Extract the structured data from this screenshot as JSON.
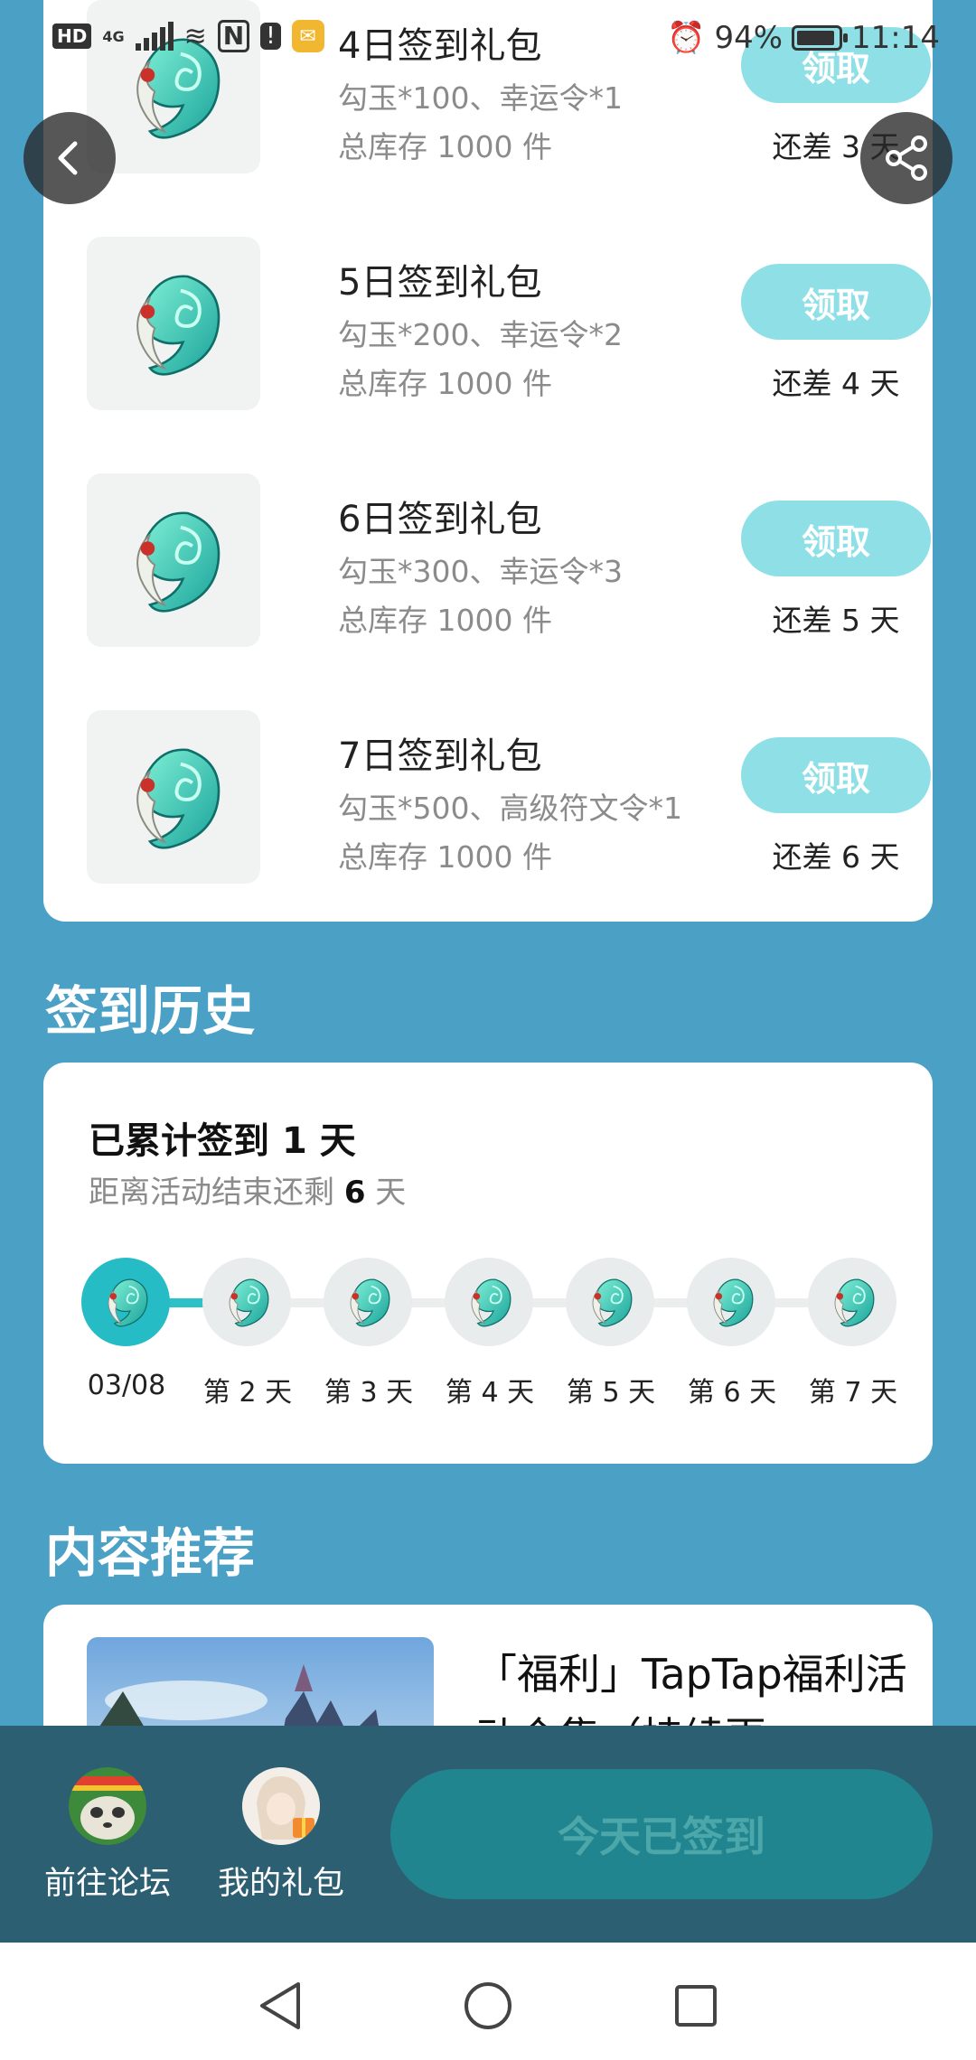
{
  "status_bar": {
    "hd": "HD",
    "network": "4G",
    "battery": "94%",
    "battery_level": 0.94,
    "time": "11:14"
  },
  "gifts": [
    {
      "title": "4日签到礼包",
      "desc": "勾玉*100、幸运令*1",
      "stock": "总库存 1000 件",
      "button": "领取",
      "remain": "还差 3 天"
    },
    {
      "title": "5日签到礼包",
      "desc": "勾玉*200、幸运令*2",
      "stock": "总库存 1000 件",
      "button": "领取",
      "remain": "还差 4 天"
    },
    {
      "title": "6日签到礼包",
      "desc": "勾玉*300、幸运令*3",
      "stock": "总库存 1000 件",
      "button": "领取",
      "remain": "还差 5 天"
    },
    {
      "title": "7日签到礼包",
      "desc": "勾玉*500、高级符文令*1",
      "stock": "总库存 1000 件",
      "button": "领取",
      "remain": "还差 6 天"
    }
  ],
  "history": {
    "title": "签到历史",
    "total_prefix": "已累计签到 ",
    "total_days": "1",
    "total_suffix": " 天",
    "end_prefix": "距离活动结束还剩 ",
    "end_days": "6",
    "end_suffix": " 天",
    "days": [
      "03/08",
      "第 2 天",
      "第 3 天",
      "第 4 天",
      "第 5 天",
      "第 6 天",
      "第 7 天"
    ]
  },
  "recommend": {
    "title": "内容推荐",
    "article_title": "「福利」TapTap福利活动合集（持续更"
  },
  "bottom_bar": {
    "forum_label": "前往论坛",
    "gifts_label": "我的礼包",
    "signed_label": "今天已签到"
  },
  "colors": {
    "background": "#4ba0c6",
    "accent": "#25bcc6",
    "claim_button": "#8fe0e6",
    "bottom_bar": "#2d5f73",
    "signed_button": "#21858f"
  }
}
